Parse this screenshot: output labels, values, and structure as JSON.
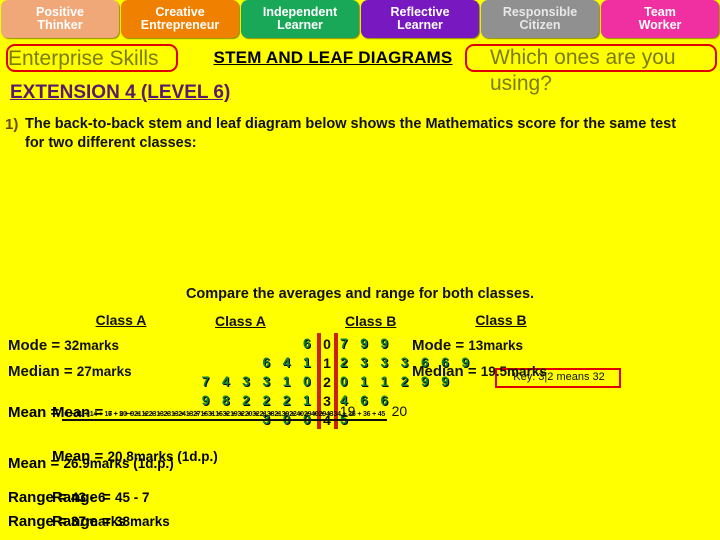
{
  "skills_bar": {
    "items": [
      {
        "line1": "Positive",
        "line2": "Thinker",
        "bg": "#F0A878",
        "fg": "#FFFFFF"
      },
      {
        "line1": "Creative",
        "line2": "Entrepreneur",
        "bg": "#F08000",
        "fg": "#FFFFFF"
      },
      {
        "line1": "Independent",
        "line2": "Learner",
        "bg": "#18A858",
        "fg": "#FFFFFF"
      },
      {
        "line1": "Reflective",
        "line2": "Learner",
        "bg": "#7818C0",
        "fg": "#FFFFFF"
      },
      {
        "line1": "Responsible",
        "line2": "Citizen",
        "bg": "#909090",
        "fg": "#E8E8E8"
      },
      {
        "line1": "Team",
        "line2": "Worker",
        "bg": "#F030A0",
        "fg": "#FFFFFF"
      }
    ]
  },
  "header": {
    "enterprise_label": "Enterprise Skills",
    "which_ones_label": "Which ones are you using?",
    "main_title": "STEM AND LEAF DIAGRAMS",
    "extension": "EXTENSION 4 (LEVEL 6)"
  },
  "question": {
    "number": "1)",
    "text": "The back-to-back stem and leaf diagram below shows the Mathematics score for the same test for two different classes:"
  },
  "stem_leaf": {
    "left_title": "Class A",
    "right_title": "Class B",
    "stems": [
      "0",
      "1",
      "2",
      "3",
      "4"
    ],
    "left_leaves": [
      "6",
      "6 4 1",
      "7 4 3 3 1 0",
      "9 8 2 2 2 1",
      "3 0 0"
    ],
    "right_leaves": [
      "7 9 9",
      "2 3 3 3 6 6 9",
      "0 1 1 2 9 9",
      "4 6 6",
      "5"
    ],
    "key": "Key: 3|2 means 32"
  },
  "compare_instruction": "Compare the averages and range for both classes.",
  "class_a": {
    "heading": "Class A",
    "mode_label": "Mode =",
    "mode_value": "32marks",
    "median_label": "Median =",
    "median_value": "27marks",
    "mean_label": "Mean =",
    "mean_numerator": "6 + 11 + 14 + 16 + 20 + 21 + 23 + 23 + 24 + 27 + 31 + 32 + 32 + 32 + 38 + 39 + 40 + 40 + 43",
    "mean_denominator": "19",
    "mean_result_label": "Mean =",
    "mean_result_value": "26.9marks (1d.p.)",
    "range_label": "Range =",
    "range_calc": "43 - 6",
    "range_result_label": "Range =",
    "range_result_value": "37marks"
  },
  "class_b": {
    "heading": "Class B",
    "mode_label": "Mode =",
    "mode_value": "13marks",
    "median_label": "Median =",
    "median_value": "19.5marks",
    "mean_label": "Mean =",
    "mean_numerator": "7 + 9 + 9 + 12 + 13 + 13 + 13 + 16 + 16 + 19 + 20 + 21 + 21 + 22 + 29 + 29 + 34 + 36 + 36 + 45",
    "mean_denominator": "20",
    "mean_result_label": "Mean =",
    "mean_result_value": "20.8marks (1d.p.)",
    "range_label": "Range =",
    "range_calc": "45 - 7",
    "range_result_label": "Range =",
    "range_result_value": "38marks"
  }
}
